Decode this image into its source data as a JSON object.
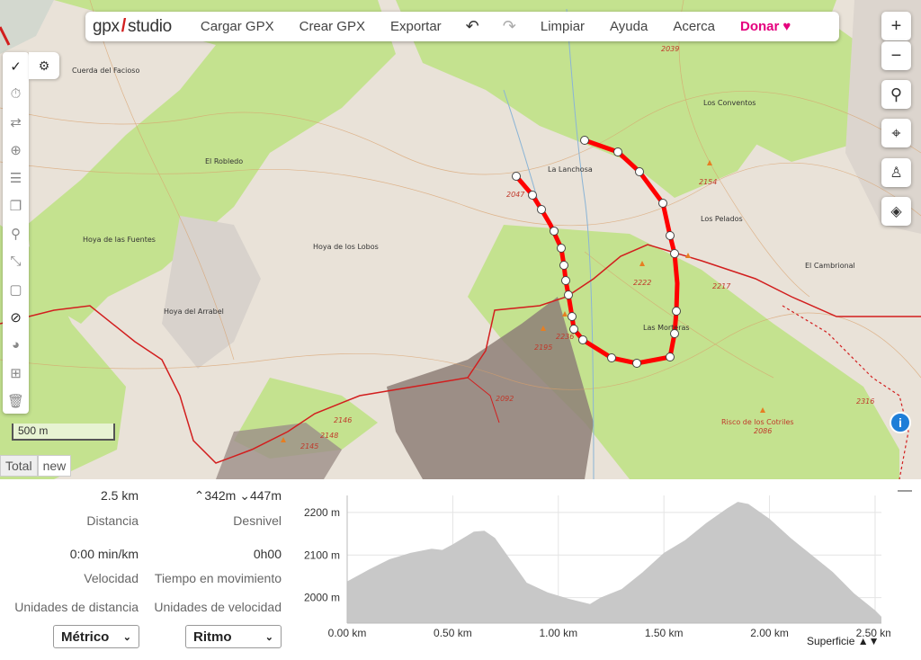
{
  "topbar": {
    "logo_left": "gpx",
    "logo_right": "studio",
    "menu": [
      "Cargar GPX",
      "Crear GPX",
      "Exportar"
    ],
    "undo_icon": "undo-icon",
    "redo_icon": "redo-icon",
    "menu2": [
      "Limpiar",
      "Ayuda",
      "Acerca"
    ],
    "donate_label": "Donar"
  },
  "map": {
    "labels": [
      {
        "text": "Cuerda del Facioso"
      },
      {
        "text": "El Robledo"
      },
      {
        "text": "Hoya de las Fuentes"
      },
      {
        "text": "Hoya de los Lobos"
      },
      {
        "text": "Hoya del Arrabel"
      },
      {
        "text": "La Lanchosa"
      },
      {
        "text": "Los Conventos"
      },
      {
        "text": "Los Pelados"
      },
      {
        "text": "El Cambrional"
      },
      {
        "text": "Las Morteras"
      },
      {
        "text": "Risco de los Cotriles"
      }
    ],
    "elevations": [
      "2039",
      "2047",
      "2154",
      "2222",
      "2217",
      "2236",
      "2195",
      "2092",
      "2146",
      "2148",
      "2145",
      "2316",
      "2086"
    ],
    "scale_label": "500 m",
    "tabs": [
      "Total",
      "new"
    ],
    "info_label": "i"
  },
  "right_controls": [
    "zoom-in-icon",
    "zoom-out-icon",
    "search-icon",
    "locate-icon",
    "street-view-icon",
    "layers-icon"
  ],
  "left_tools": [
    "check-icon",
    "stopwatch-icon",
    "reverse-icon",
    "plus-circle-icon",
    "list-icon",
    "copy-icon",
    "pin-icon",
    "compress-icon",
    "crop-icon",
    "hide-icon",
    "palette-icon",
    "extract-icon",
    "trash-icon"
  ],
  "stats": {
    "distance_value": "2.5 km",
    "distance_label": "Distancia",
    "elev_up": "342m",
    "elev_down": "447m",
    "elev_label": "Desnivel",
    "speed_value": "0:00 min/km",
    "speed_label": "Velocidad",
    "moving_value": "0h00",
    "moving_label": "Tiempo en movimiento",
    "dist_units_label": "Unidades de distancia",
    "speed_units_label": "Unidades de velocidad",
    "dist_units_value": "Métrico",
    "speed_units_value": "Ritmo",
    "surface_label": "Superficie"
  },
  "chart_data": {
    "type": "area",
    "x": [
      0,
      0.1,
      0.2,
      0.3,
      0.4,
      0.45,
      0.5,
      0.6,
      0.65,
      0.7,
      0.75,
      0.85,
      0.95,
      1.05,
      1.15,
      1.2,
      1.3,
      1.4,
      1.5,
      1.6,
      1.7,
      1.8,
      1.85,
      1.9,
      2.0,
      2.1,
      2.2,
      2.3,
      2.4,
      2.5,
      2.53
    ],
    "y": [
      2038,
      2065,
      2090,
      2105,
      2115,
      2112,
      2125,
      2155,
      2157,
      2140,
      2105,
      2035,
      2012,
      1997,
      1985,
      2000,
      2020,
      2060,
      2105,
      2135,
      2175,
      2210,
      2225,
      2220,
      2185,
      2140,
      2100,
      2060,
      2010,
      1970,
      1955
    ],
    "xticks": [
      "0.00 km",
      "0.50 km",
      "1.00 km",
      "1.50 km",
      "2.00 km",
      "2.50 km"
    ],
    "yticks": [
      "2000 m",
      "2100 m",
      "2200 m"
    ],
    "xlim": [
      0,
      2.53
    ],
    "ylim": [
      1940,
      2240
    ],
    "fill": "#c8c8c8",
    "grid": true
  }
}
